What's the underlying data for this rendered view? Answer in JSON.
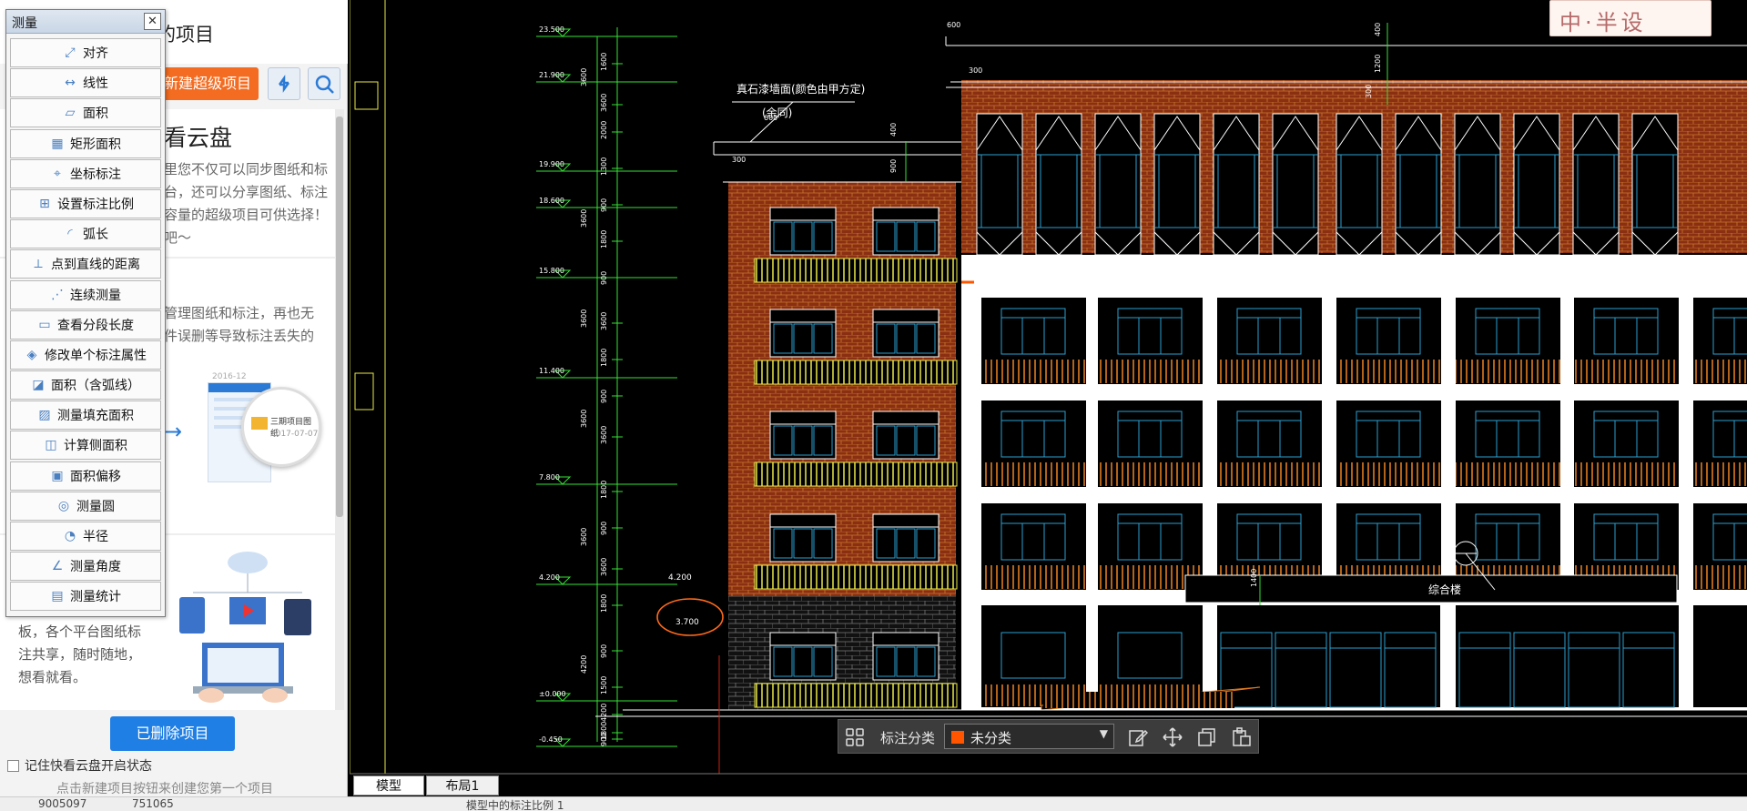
{
  "left_panel": {
    "title_partial": "的项目",
    "new_super_project": "新建超级项目",
    "cloud_title": "看云盘",
    "para1": [
      "里您不仅可以同步图纸和标",
      "台，还可以分享图纸、标注",
      "容量的超级项目可供选择！",
      "吧～"
    ],
    "para2": [
      "管理图纸和标注，再也无",
      "件误删等导致标注丢失的"
    ],
    "para3": [
      "板，各个平台图纸标",
      "注共享，随时随地，",
      "想看就看。"
    ],
    "preview_folder": "三期项目图纸",
    "preview_date": "2017-07-07",
    "preview_date2": "2016-12",
    "deleted_button": "已删除项目",
    "remember_label": "记住快看云盘开启状态",
    "hint": "点击新建项目按钮来创建您第一个项目"
  },
  "measure_panel": {
    "title": "测量",
    "close": "✕",
    "items": [
      {
        "label": "对齐",
        "icon": "aligned-dim-icon"
      },
      {
        "label": "线性",
        "icon": "linear-dim-icon"
      },
      {
        "label": "面积",
        "icon": "area-icon"
      },
      {
        "label": "矩形面积",
        "icon": "rect-area-icon"
      },
      {
        "label": "坐标标注",
        "icon": "coordinate-icon"
      },
      {
        "label": "设置标注比例",
        "icon": "scale-icon"
      },
      {
        "label": "弧长",
        "icon": "arc-length-icon"
      },
      {
        "label": "点到直线的距离",
        "icon": "point-line-icon"
      },
      {
        "label": "连续测量",
        "icon": "continuous-icon"
      },
      {
        "label": "查看分段长度",
        "icon": "segment-icon"
      },
      {
        "label": "修改单个标注属性",
        "icon": "edit-dim-icon"
      },
      {
        "label": "面积（含弧线）",
        "icon": "arc-area-icon"
      },
      {
        "label": "测量填充面积",
        "icon": "hatch-area-icon"
      },
      {
        "label": "计算侧面积",
        "icon": "side-area-icon"
      },
      {
        "label": "面积偏移",
        "icon": "area-offset-icon"
      },
      {
        "label": "测量圆",
        "icon": "circle-icon"
      },
      {
        "label": "半径",
        "icon": "radius-icon"
      },
      {
        "label": "测量角度",
        "icon": "angle-icon"
      },
      {
        "label": "测量统计",
        "icon": "stats-icon"
      }
    ]
  },
  "cad": {
    "tabs": [
      "模型",
      "布局1"
    ],
    "status_text": "模型中的标注比例 1",
    "status_left": [
      "9005097",
      "751065"
    ],
    "note_title": "真石漆墙面(颜色由甲方定)",
    "note_sub": "(余同)",
    "sign_text": "综合楼",
    "elevations": [
      "23.500",
      "21.900",
      "19.900",
      "18.600",
      "15.800",
      "11.400",
      "7.800",
      "4.200",
      "±0.000",
      "-0.450"
    ],
    "dims": [
      "1600",
      "3600",
      "2000",
      "1300",
      "900",
      "1800",
      "900",
      "3600",
      "1800",
      "900",
      "3600",
      "1800",
      "900",
      "3600",
      "1800",
      "900",
      "1500",
      "4200",
      "1800",
      "900",
      "450",
      "450"
    ],
    "top_dims": [
      "600",
      "300",
      "400",
      "1200",
      "300",
      "600",
      "300",
      "400",
      "900",
      "300"
    ],
    "circled_value": "3.700",
    "level_4200_side": "4.200",
    "dim_1400": "1400",
    "watermark": "中·半设"
  },
  "toolbar": {
    "group_label": "标注分类",
    "select_value": "未分类",
    "swatch_color": "#ff5500"
  },
  "colors": {
    "accent_orange": "#f36c21",
    "accent_blue": "#1f7fe5"
  }
}
